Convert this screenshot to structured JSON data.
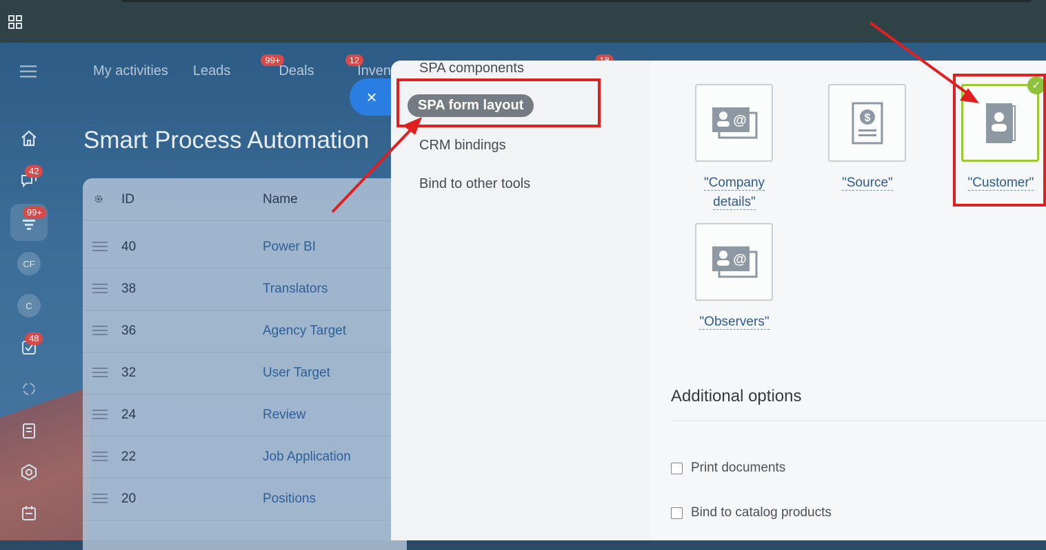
{
  "top_nav": [
    {
      "label": "My activities",
      "badge": ""
    },
    {
      "label": "Leads",
      "badge": "99+"
    },
    {
      "label": "Deals",
      "badge": "12"
    },
    {
      "label": "Inventory",
      "badge": "18"
    }
  ],
  "page_title": "Smart Process Automation",
  "rail": {
    "badges": {
      "chat": "42",
      "crm": "99+",
      "tasks": "48"
    },
    "circles": [
      "CF",
      "C"
    ]
  },
  "table": {
    "headers": {
      "id": "ID",
      "name": "Name"
    },
    "rows": [
      {
        "id": "40",
        "name": "Power BI"
      },
      {
        "id": "38",
        "name": "Translators"
      },
      {
        "id": "36",
        "name": "Agency Target"
      },
      {
        "id": "32",
        "name": "User Target"
      },
      {
        "id": "24",
        "name": "Review"
      },
      {
        "id": "22",
        "name": "Job Application"
      },
      {
        "id": "20",
        "name": "Positions"
      }
    ]
  },
  "close_label": "×",
  "slider_menu": [
    "SPA components",
    "SPA form layout",
    "CRM bindings",
    "Bind to other tools"
  ],
  "tiles": [
    {
      "label": "\"Company details\"",
      "line1": "\"Company",
      "line2": "details\"",
      "icon": "contact-card-icon"
    },
    {
      "label": "\"Source\"",
      "icon": "dollar-document-icon"
    },
    {
      "label": "\"Customer\"",
      "icon": "address-book-icon",
      "selected": true
    },
    {
      "label": "\"Observers\"",
      "icon": "contact-card-icon"
    }
  ],
  "additional": {
    "title": "Additional options",
    "options": [
      "Print documents",
      "Bind to catalog products"
    ]
  },
  "colors": {
    "accent_blue": "#2a7ee2",
    "highlight_red": "#e02020",
    "selected_green": "#9cc930"
  }
}
